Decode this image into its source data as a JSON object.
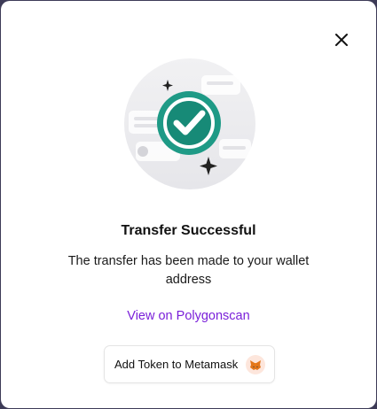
{
  "modal": {
    "title": "Transfer Successful",
    "message": "The transfer has been made to your wallet address",
    "explorer_link": "View on Polygonscan",
    "add_token_button": "Add Token to Metamask",
    "close_icon": "close-icon",
    "success_icon": "check-circle-icon",
    "wallet_icon": "metamask-fox-icon"
  },
  "colors": {
    "accent_link": "#7a1fd9",
    "success_teal": "#1e9a86",
    "backdrop": "#3d3b57"
  }
}
